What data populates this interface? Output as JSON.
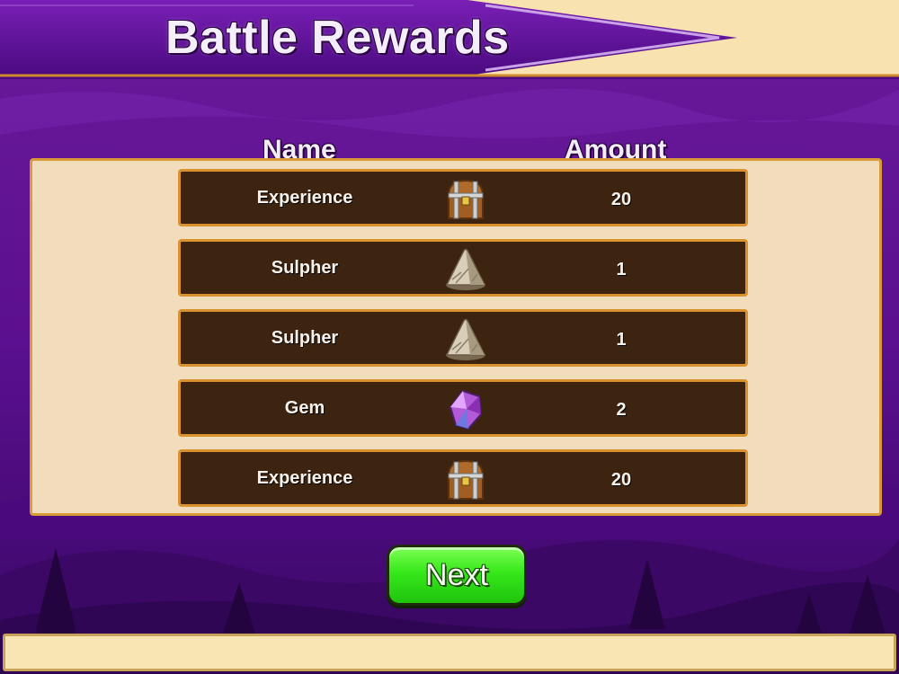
{
  "title": "Battle Rewards",
  "columns": {
    "name": "Name",
    "amount": "Amount"
  },
  "rewards": [
    {
      "name": "Experience",
      "icon": "treasure-chest-icon",
      "amount": "20"
    },
    {
      "name": "Sulpher",
      "icon": "sulphur-pile-icon",
      "amount": "1"
    },
    {
      "name": "Sulpher",
      "icon": "sulphur-pile-icon",
      "amount": "1"
    },
    {
      "name": "Gem",
      "icon": "purple-gem-icon",
      "amount": "2"
    },
    {
      "name": "Experience",
      "icon": "treasure-chest-icon",
      "amount": "20"
    }
  ],
  "next_button": {
    "label": "Next"
  },
  "colors": {
    "background": "#5a0f86",
    "panel": "#f1dcbb",
    "row": "#3c2410",
    "row_border": "#d9922e",
    "button": "#36e81a"
  }
}
